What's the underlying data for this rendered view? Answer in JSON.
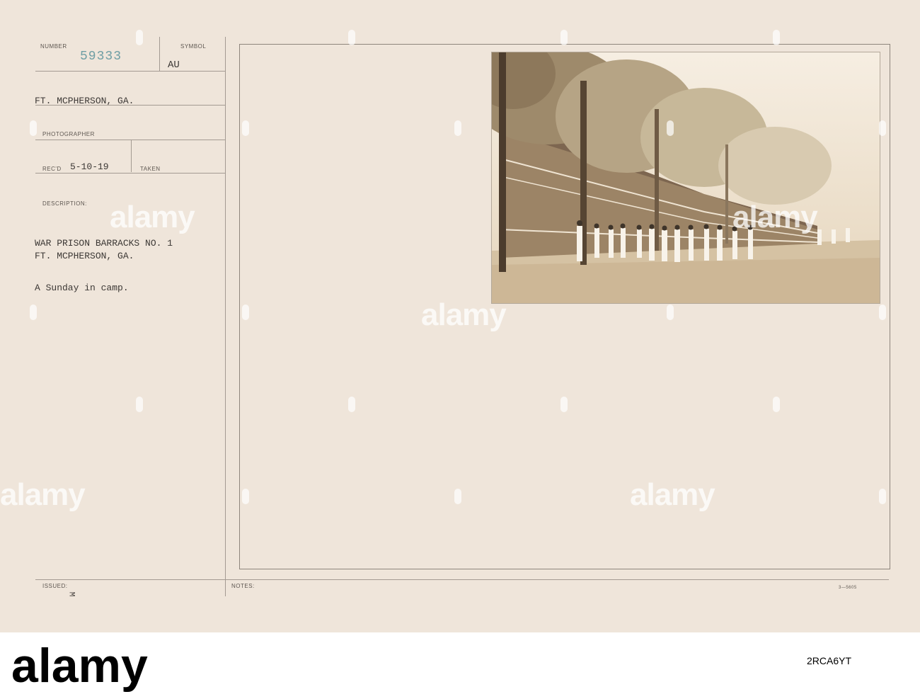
{
  "record": {
    "number_label": "NUMBER",
    "number_value": "59333",
    "symbol_label": "SYMBOL",
    "symbol_value": "AU",
    "location": "FT. MCPHERSON, GA.",
    "photographer_label": "PHOTOGRAPHER",
    "recd_label": "REC'D",
    "recd_value": "5-10-19",
    "taken_label": "TAKEN",
    "description_label": "DESCRIPTION:",
    "description_line1": "WAR PRISON BARRACKS NO. 1",
    "description_line2": "FT. MCPHERSON, GA.",
    "description_line3": "A Sunday in camp.",
    "issued_label": "ISSUED:",
    "issued_mark": "M",
    "notes_label": "NOTES:",
    "form_code": "3—5605"
  },
  "watermark": {
    "text": "alamy",
    "id_text": "2RCA6YT"
  },
  "colors": {
    "card": "#efe5da",
    "number_ink": "#6e9ea4",
    "typed_ink": "#3c3835"
  }
}
